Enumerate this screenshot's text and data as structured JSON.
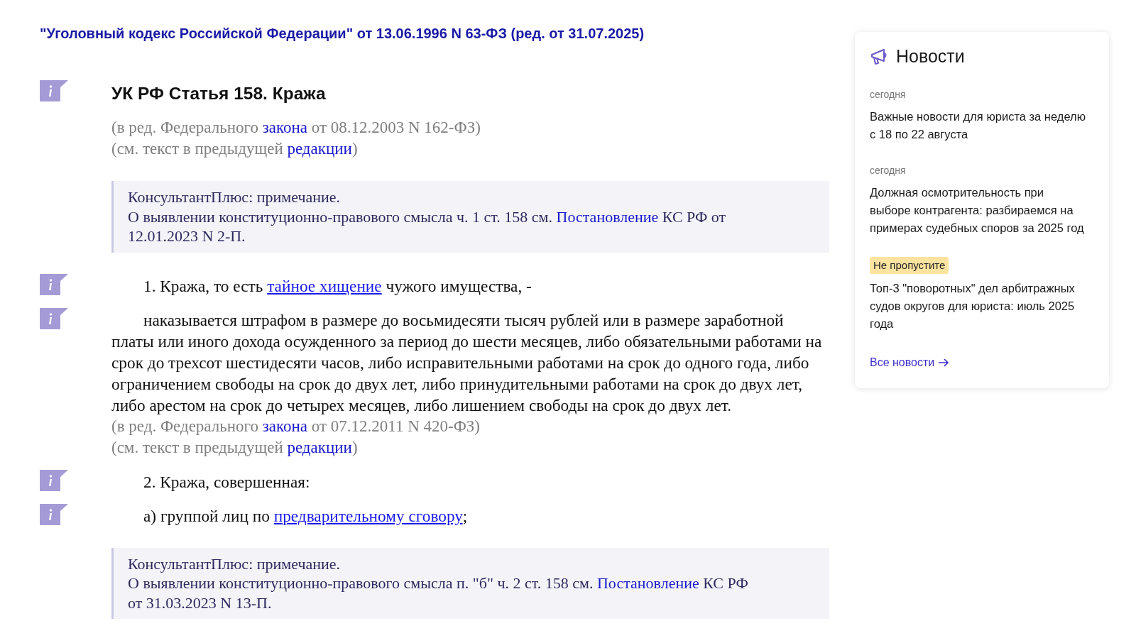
{
  "document_title": "\"Уголовный кодекс Российской Федерации\" от 13.06.1996 N 63-ФЗ (ред. от 31.07.2025)",
  "blocks": [
    {
      "kind": "heading",
      "info_icon": true,
      "segments": [
        {
          "kind": "text",
          "text": "УК РФ Статья 158. Кража"
        }
      ]
    },
    {
      "kind": "edition",
      "info_icon": false,
      "segments": [
        {
          "kind": "text",
          "text": "(в ред. Федерального "
        },
        {
          "kind": "link",
          "text": "закона"
        },
        {
          "kind": "text",
          "text": " от 08.12.2003 N 162-ФЗ)"
        }
      ]
    },
    {
      "kind": "edition",
      "info_icon": false,
      "segments": [
        {
          "kind": "text",
          "text": "(см. текст в предыдущей "
        },
        {
          "kind": "link",
          "text": "редакции"
        },
        {
          "kind": "text",
          "text": ")"
        }
      ]
    },
    {
      "kind": "note",
      "info_icon": false,
      "title": "КонсультантПлюс: примечание.",
      "segments": [
        {
          "kind": "text",
          "text": "О выявлении конституционно-правового смысла ч. 1 ст. 158 см. "
        },
        {
          "kind": "link",
          "text": "Постановление"
        },
        {
          "kind": "text",
          "text": " КС РФ от 12.01.2023 N 2-П."
        }
      ]
    },
    {
      "kind": "paragraph",
      "info_icon": true,
      "segments": [
        {
          "kind": "text",
          "text": "1. Кража, то есть "
        },
        {
          "kind": "link",
          "text": "тайное хищение"
        },
        {
          "kind": "text",
          "text": " чужого имущества, -"
        }
      ]
    },
    {
      "kind": "paragraph",
      "info_icon": true,
      "segments": [
        {
          "kind": "text",
          "text": "наказывается штрафом в размере до восьмидесяти тысяч рублей или в размере заработной платы или иного дохода осужденного за период до шести месяцев, либо обязательными работами на срок до трехсот шестидесяти часов, либо исправительными работами на срок до одного года, либо ограничением свободы на срок до двух лет, либо принудительными работами на срок до двух лет, либо арестом на срок до четырех месяцев, либо лишением свободы на срок до двух лет."
        }
      ]
    },
    {
      "kind": "edition",
      "info_icon": false,
      "segments": [
        {
          "kind": "text",
          "text": "(в ред. Федерального "
        },
        {
          "kind": "link",
          "text": "закона"
        },
        {
          "kind": "text",
          "text": " от 07.12.2011 N 420-ФЗ)"
        }
      ]
    },
    {
      "kind": "edition",
      "info_icon": false,
      "segments": [
        {
          "kind": "text",
          "text": "(см. текст в предыдущей "
        },
        {
          "kind": "link",
          "text": "редакции"
        },
        {
          "kind": "text",
          "text": ")"
        }
      ]
    },
    {
      "kind": "paragraph",
      "info_icon": true,
      "segments": [
        {
          "kind": "text",
          "text": "2. Кража, совершенная:"
        }
      ]
    },
    {
      "kind": "paragraph",
      "info_icon": true,
      "segments": [
        {
          "kind": "text",
          "text": "а) группой лиц по "
        },
        {
          "kind": "link",
          "text": "предварительному сговору"
        },
        {
          "kind": "text",
          "text": ";"
        }
      ]
    },
    {
      "kind": "note",
      "info_icon": false,
      "title": "КонсультантПлюс: примечание.",
      "segments": [
        {
          "kind": "text",
          "text": "О выявлении конституционно-правового смысла п. \"б\" ч. 2 ст. 158 см. "
        },
        {
          "kind": "link",
          "text": "Постановление"
        },
        {
          "kind": "text",
          "text": " КС РФ от 31.03.2023 N 13-П."
        }
      ]
    }
  ],
  "news": {
    "title": "Новости",
    "items": [
      {
        "kind": "date",
        "label": "сегодня",
        "headline": "Важные новости для юриста за неделю с 18 по 22 августа"
      },
      {
        "kind": "date",
        "label": "сегодня",
        "headline": "Должная осмотрительность при выборе контрагента: разбираемся на примерах судебных споров за 2025 год"
      },
      {
        "kind": "tag",
        "label": "Не пропустите",
        "headline": "Топ-3 \"поворотных\" дел арбитражных судов округов для юриста: июль 2025 года"
      }
    ],
    "all_link": "Все новости"
  }
}
